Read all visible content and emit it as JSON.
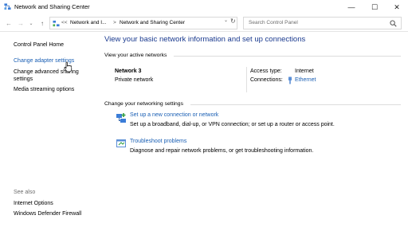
{
  "window": {
    "title": "Network and Sharing Center",
    "minimize": "—",
    "maximize": "☐",
    "close": "✕"
  },
  "address": {
    "back": "←",
    "forward": "→",
    "history": "⌄",
    "up": "↑",
    "overflow": "<<",
    "crumbs": [
      "Network and I...",
      "Network and Sharing Center"
    ],
    "separator": ">",
    "dropdown": "⌄",
    "refresh": "↻"
  },
  "search": {
    "placeholder": "Search Control Panel"
  },
  "sidebar": {
    "home": "Control Panel Home",
    "items": [
      "Change adapter settings",
      "Change advanced sharing settings",
      "Media streaming options"
    ],
    "see_also_title": "See also",
    "see_also": [
      "Internet Options",
      "Windows Defender Firewall"
    ]
  },
  "main": {
    "heading": "View your basic network information and set up connections",
    "active_title": "View your active networks",
    "network": {
      "name": "Network 3",
      "type": "Private network",
      "access_label": "Access type:",
      "access_value": "Internet",
      "connections_label": "Connections:",
      "connection": "Ethernet"
    },
    "change_title": "Change your networking settings",
    "tasks": [
      {
        "link": "Set up a new connection or network",
        "desc": "Set up a broadband, dial-up, or VPN connection; or set up a router or access point."
      },
      {
        "link": "Troubleshoot problems",
        "desc": "Diagnose and repair network problems, or get troubleshooting information."
      }
    ]
  },
  "icons": {
    "app": "network-sharing-icon",
    "search": "search-icon",
    "ethernet": "ethernet-icon",
    "new_connection": "new-connection-icon",
    "troubleshoot": "troubleshoot-icon",
    "cursor": "mouse-cursor-icon"
  },
  "colors": {
    "link": "#1a5fb4",
    "heading": "#1a3a8f",
    "muted": "#6d6d6d"
  }
}
